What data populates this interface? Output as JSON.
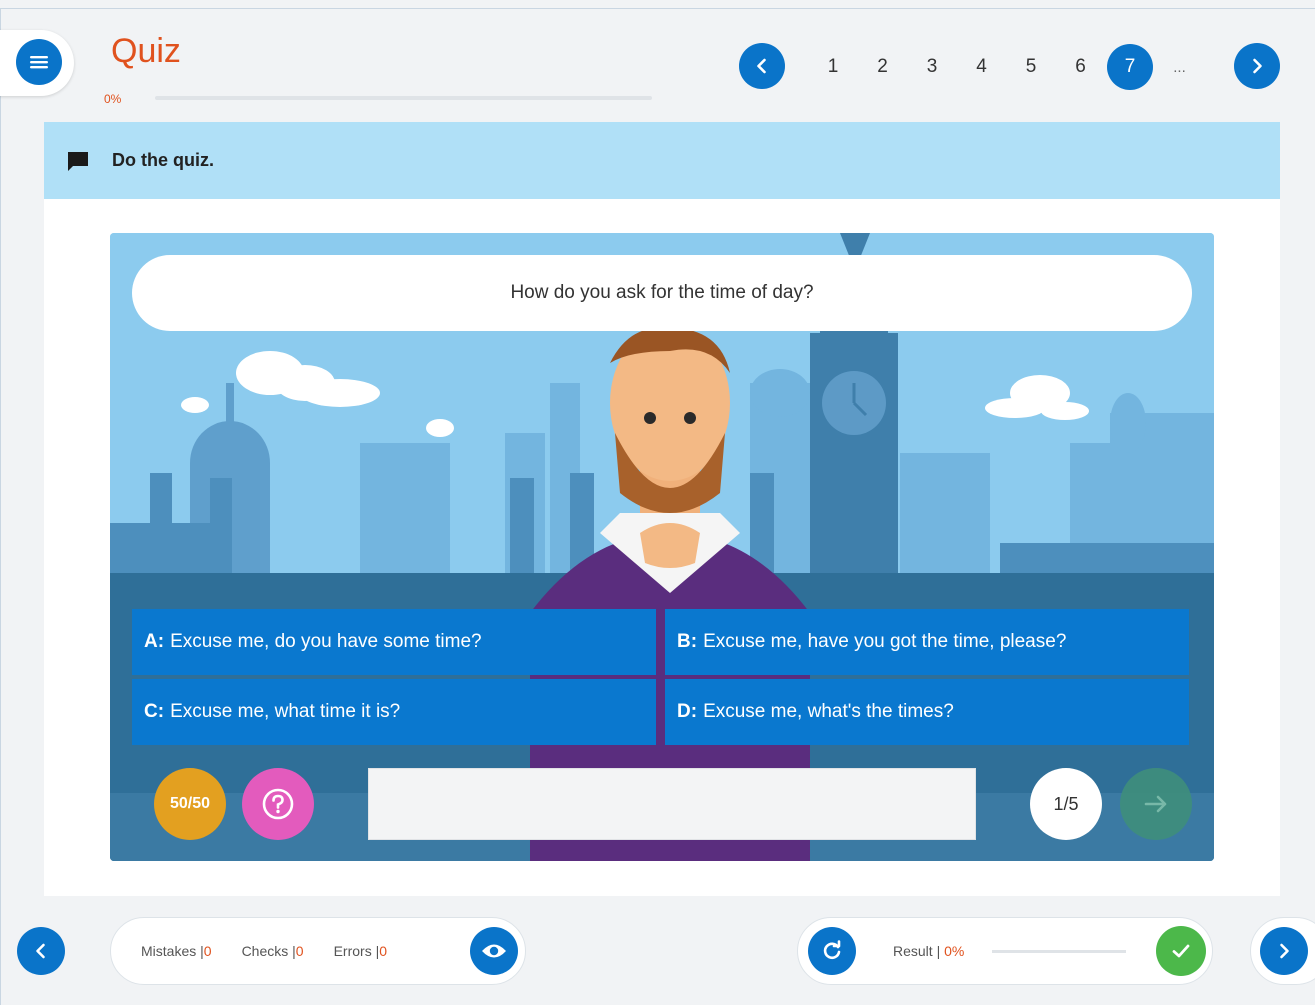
{
  "header": {
    "title": "Quiz",
    "progress_percent": 0,
    "progress_label": "0%"
  },
  "pagination": {
    "pages": [
      "1",
      "2",
      "3",
      "4",
      "5",
      "6",
      "7",
      "..."
    ],
    "active_page": "7"
  },
  "instruction": {
    "text": "Do the quiz.",
    "icon": "speech-bubble-icon"
  },
  "quiz": {
    "question": "How do you ask for the time of day?",
    "answers": [
      {
        "letter": "A:",
        "text": "Excuse me, do you have some time?"
      },
      {
        "letter": "B:",
        "text": "Excuse me, have you got the time, please?"
      },
      {
        "letter": "C:",
        "text": "Excuse me, what time it is?"
      },
      {
        "letter": "D:",
        "text": "Excuse me, what's the times?"
      }
    ],
    "fifty_fifty_label": "50/50",
    "counter": "1/5"
  },
  "footer": {
    "stats": [
      {
        "label": "Mistakes |",
        "value": "0"
      },
      {
        "label": "Checks |",
        "value": "0"
      },
      {
        "label": "Errors |",
        "value": "0"
      }
    ],
    "result_label": "Result |",
    "result_value": "0%"
  },
  "colors": {
    "primary_blue": "#0a74c9",
    "accent_orange": "#e0521e",
    "instruction_bg": "#b0e0f7",
    "fifty_fifty": "#e3a020",
    "hint": "#e35bbd",
    "check": "#4cb84a"
  }
}
